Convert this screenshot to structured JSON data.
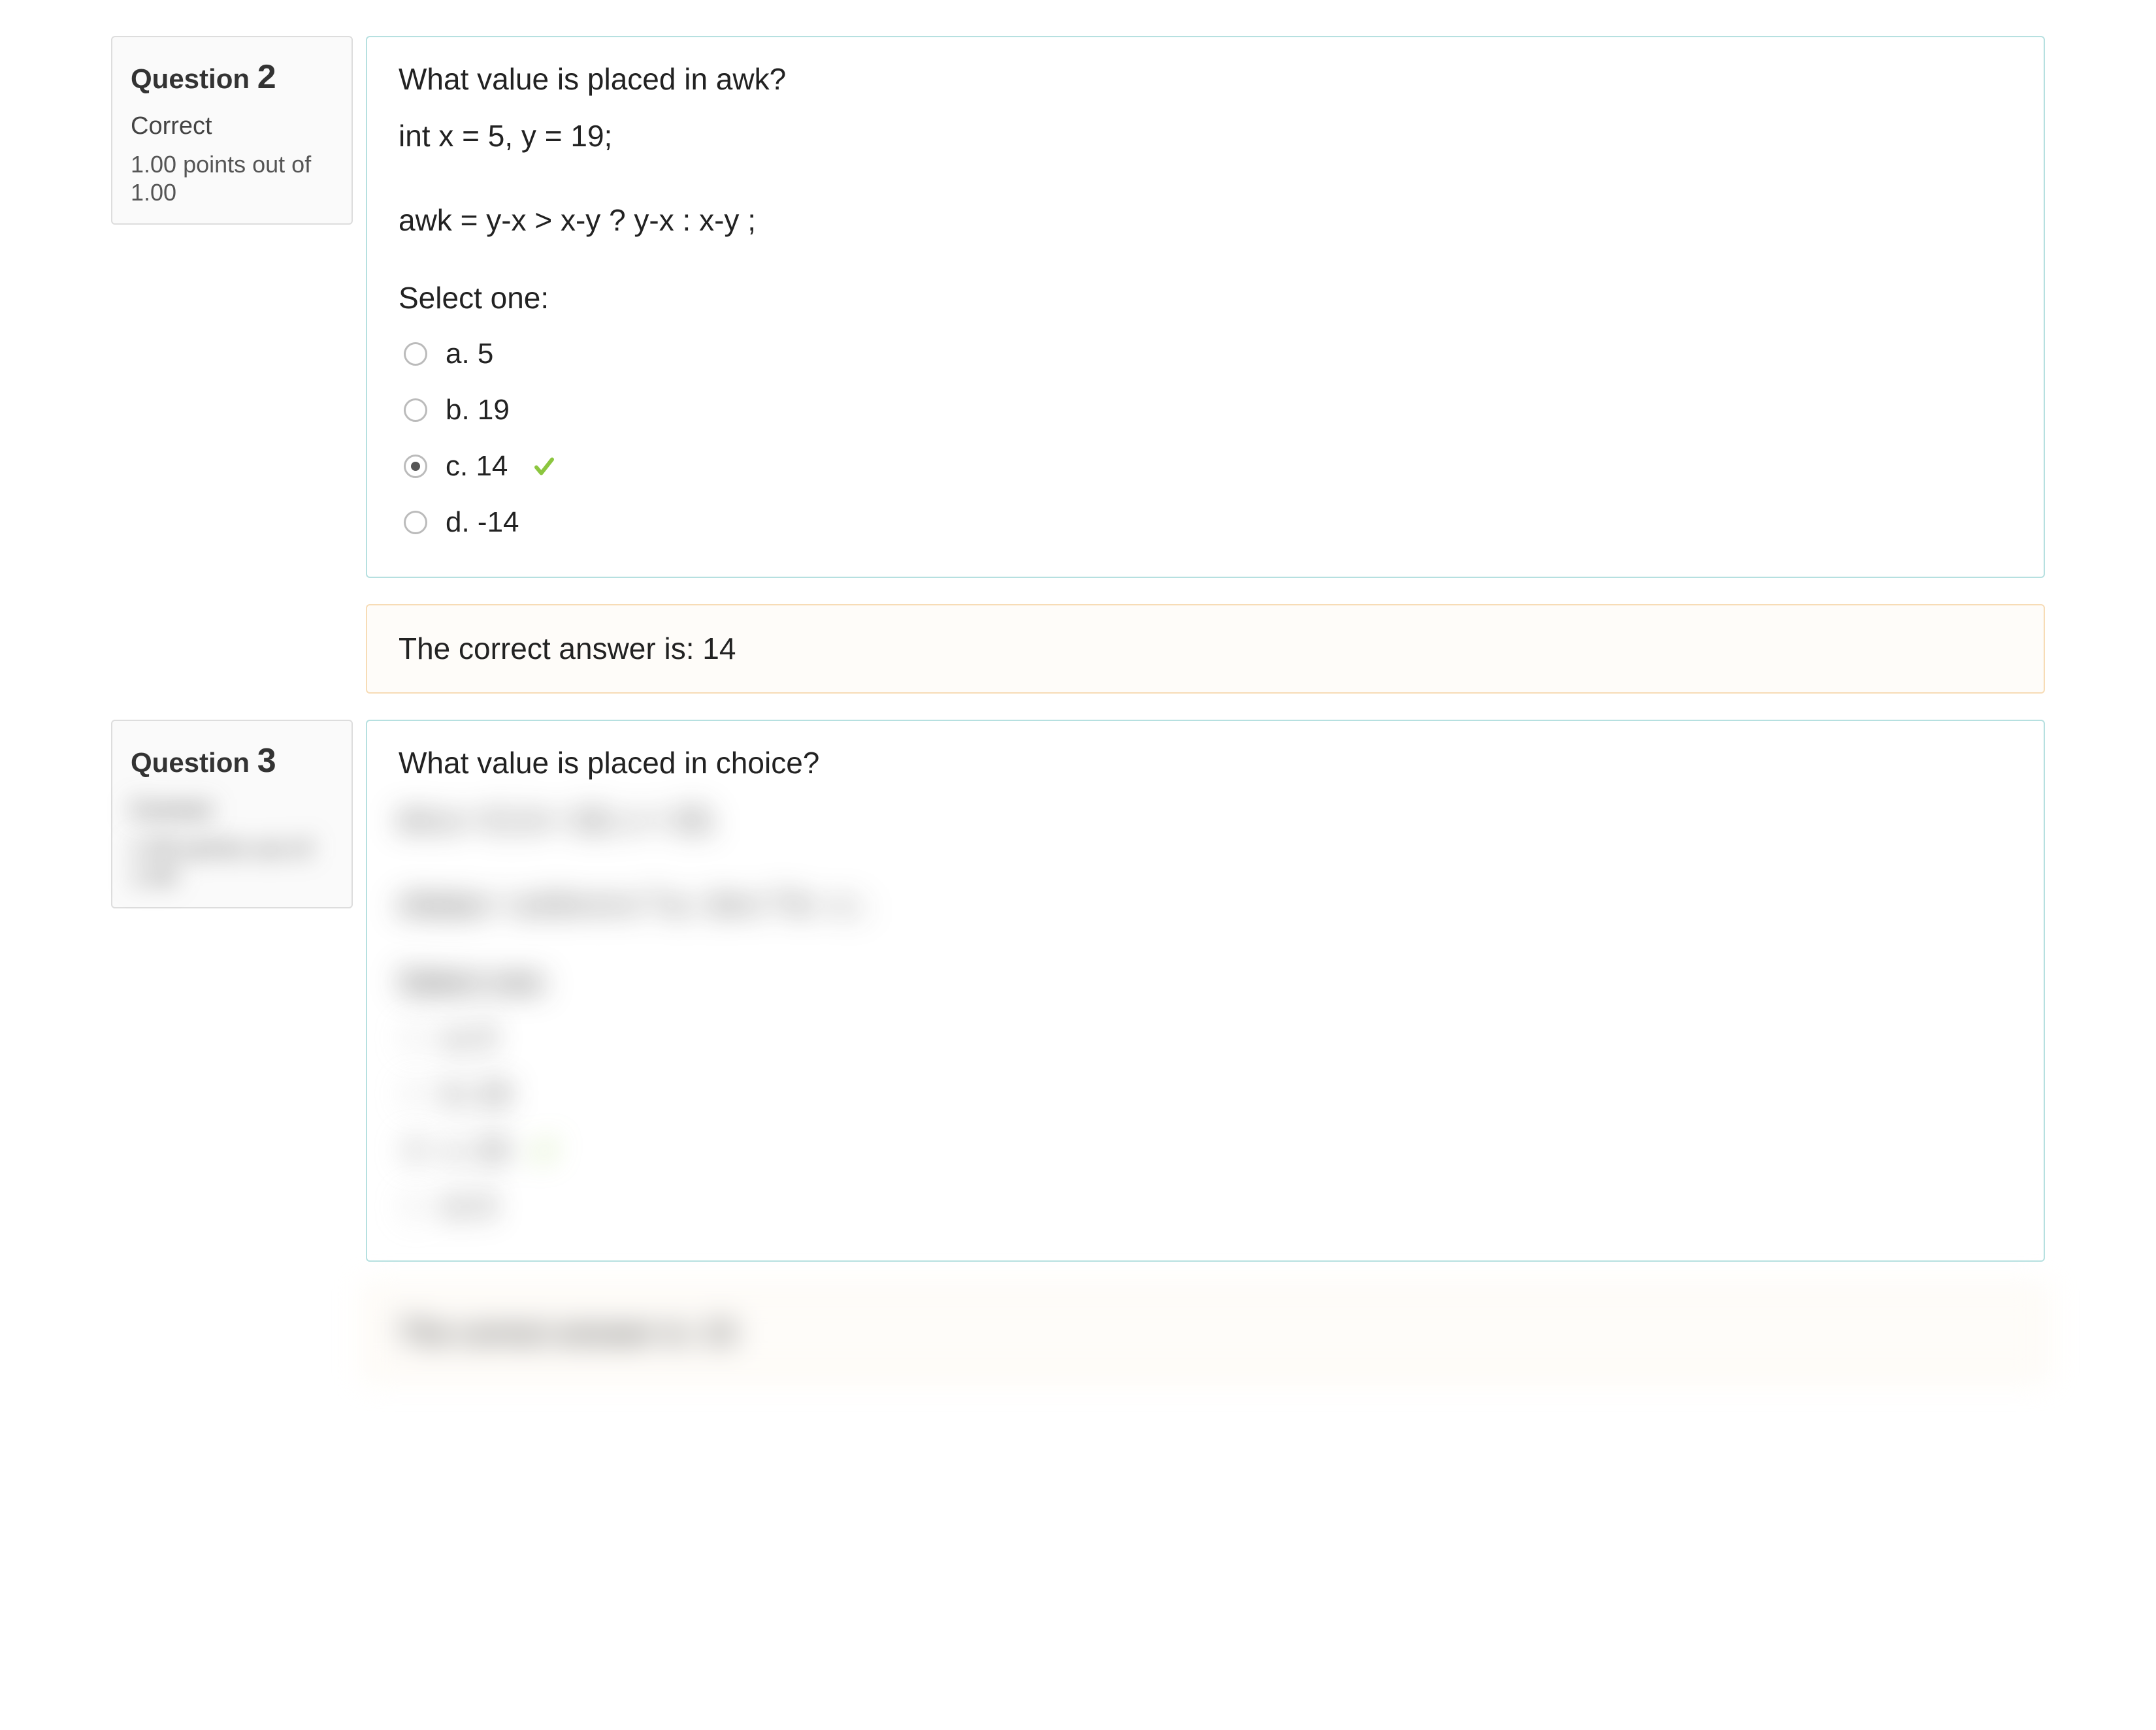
{
  "q2": {
    "info_label": "Question",
    "number": "2",
    "status": "Correct",
    "points": "1.00 points out of 1.00",
    "prompt": "What value is placed in awk?",
    "code1": "int x = 5, y = 19;",
    "code2": "awk = y-x > x-y ? y-x : x-y ;",
    "select_label": "Select one:",
    "options": {
      "a": "a. 5",
      "b": "b. 19",
      "c": "c. 14",
      "d": "d. -14"
    },
    "correct_text": "The correct answer is: 14"
  },
  "q3": {
    "info_label": "Question",
    "number": "3",
    "status": "Correct",
    "points": "1.00 points out of 1.00",
    "prompt": "What value is placed in choice?",
    "code1": "int a = 0, b = 10, c = 15;",
    "code2": "choice = a+b+c>x ? a : b>c ? b : c ;",
    "select_label": "Select one:",
    "options": {
      "a": "a. 0",
      "b": "b. 10",
      "c": "c. 15",
      "d": "d. 0"
    },
    "correct_text": "The correct answer is: 15"
  }
}
